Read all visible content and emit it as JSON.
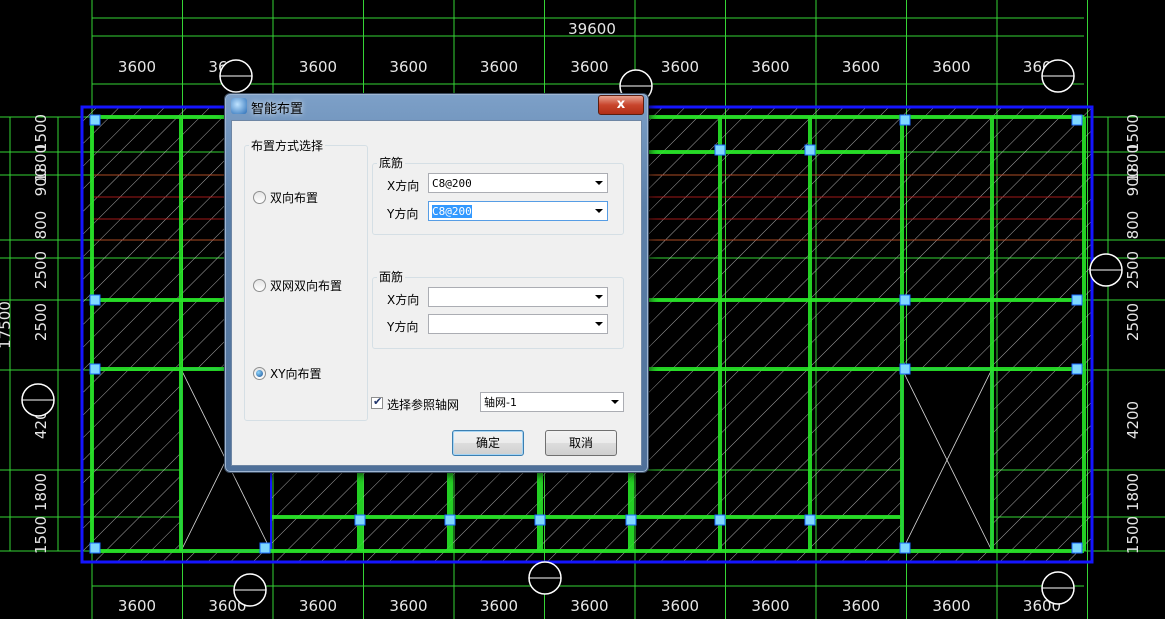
{
  "cad": {
    "overall_dimension": "39600",
    "bay_dimension": "3600",
    "top_bays": [
      "3600",
      "3600",
      "3600",
      "3600",
      "3600",
      "3600",
      "3600",
      "3600",
      "3600",
      "3600",
      "3600"
    ],
    "bottom_bays": [
      "3600",
      "3600",
      "3600",
      "3600",
      "3600",
      "3600",
      "3600",
      "3600",
      "3600",
      "3600",
      "3600"
    ],
    "left_dims": [
      "1500",
      "1800",
      "900",
      "2500",
      "800",
      "2500",
      "4200",
      "1800",
      "1500"
    ],
    "left_total": "17500",
    "right_dims": [
      "1500",
      "1800",
      "900",
      "2500",
      "800",
      "2500",
      "4200",
      "1800",
      "1500"
    ],
    "colors": {
      "axis_lines": "#35d335",
      "beams": "#29e629",
      "slab_border": "#1515ff",
      "hatch": "#cfcfcf",
      "rebar_red": "#d42020",
      "columns": "#7fd8ff"
    }
  },
  "dialog": {
    "title": "智能布置",
    "close_label": "x",
    "method_group": {
      "label": "布置方式选择",
      "options": [
        {
          "label": "双向布置",
          "selected": false
        },
        {
          "label": "双网双向布置",
          "selected": false
        },
        {
          "label": "XY向布置",
          "selected": true
        }
      ]
    },
    "bottom_bar": {
      "label": "底筋",
      "x_label": "X方向",
      "x_value": "C8@200",
      "y_label": "Y方向",
      "y_value": "C8@200"
    },
    "top_bar": {
      "label": "面筋",
      "x_label": "X方向",
      "x_value": "",
      "y_label": "Y方向",
      "y_value": ""
    },
    "ref_grid": {
      "checkbox_label": "选择参照轴网",
      "checked": true,
      "value": "轴网-1"
    },
    "ok_label": "确定",
    "cancel_label": "取消"
  }
}
